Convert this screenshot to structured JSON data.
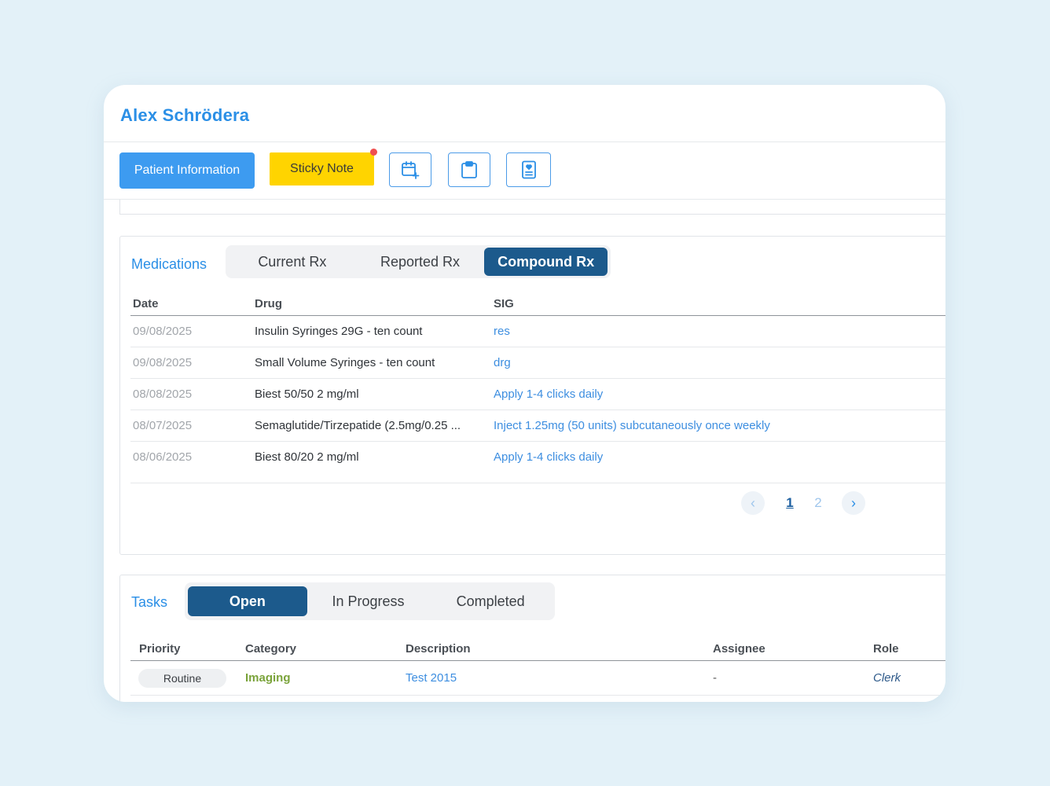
{
  "patient": {
    "name": "Alex Schrödera"
  },
  "toolbar": {
    "patient_info_label": "Patient Information",
    "sticky_note_label": "Sticky Note",
    "icons": [
      "calendar-plus-icon",
      "clipboard-icon",
      "medical-record-icon"
    ]
  },
  "medications": {
    "title": "Medications",
    "tabs": [
      {
        "label": "Current Rx",
        "active": false
      },
      {
        "label": "Reported Rx",
        "active": false
      },
      {
        "label": "Compound Rx",
        "active": true
      }
    ],
    "columns": {
      "date": "Date",
      "drug": "Drug",
      "sig": "SIG"
    },
    "rows": [
      {
        "date": "09/08/2025",
        "drug": "Insulin Syringes 29G - ten count",
        "sig": "res"
      },
      {
        "date": "09/08/2025",
        "drug": "Small Volume Syringes - ten count",
        "sig": "drg"
      },
      {
        "date": "08/08/2025",
        "drug": "Biest 50/50 2 mg/ml",
        "sig": "Apply 1-4 clicks daily"
      },
      {
        "date": "08/07/2025",
        "drug": "Semaglutide/Tirzepatide (2.5mg/0.25 ...",
        "sig": "Inject 1.25mg (50 units) subcutaneously once weekly"
      },
      {
        "date": "08/06/2025",
        "drug": "Biest 80/20 2 mg/ml",
        "sig": "Apply 1-4 clicks daily"
      }
    ],
    "pagination": {
      "pages": [
        "1",
        "2"
      ],
      "current": "1"
    }
  },
  "tasks": {
    "title": "Tasks",
    "tabs": [
      {
        "label": "Open",
        "active": true
      },
      {
        "label": "In Progress",
        "active": false
      },
      {
        "label": "Completed",
        "active": false
      }
    ],
    "columns": {
      "priority": "Priority",
      "category": "Category",
      "description": "Description",
      "assignee": "Assignee",
      "role": "Role"
    },
    "rows": [
      {
        "priority": "Routine",
        "category": "Imaging",
        "description": "Test 2015",
        "assignee": "-",
        "role": "Clerk"
      }
    ]
  },
  "colors": {
    "accent": "#2b8fe6",
    "primary_button": "#3d9bf0",
    "sticky": "#ffd400",
    "active_tab": "#1c5a8c",
    "notification_dot": "#ef4f4f",
    "category_imaging": "#7aa33a"
  }
}
